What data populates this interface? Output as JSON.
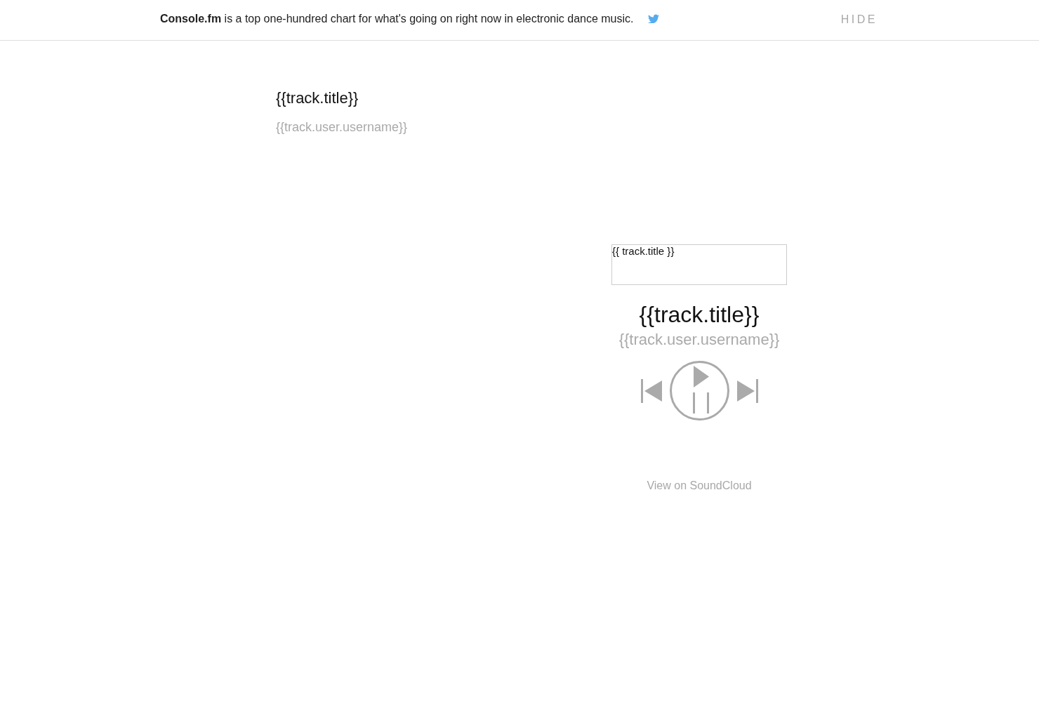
{
  "header": {
    "intro": "**Console.fm** is a top one-hundred chart for what's going on right now in electronic dance music.",
    "hide_button": "HIDE"
  },
  "track_list": [
    {
      "title": "{{track.title}}",
      "username": "{{track.user.username}}"
    }
  ],
  "player": {
    "artwork_alt": "{{ track.title }}",
    "title": "{{track.title}}",
    "username": "{{track.user.username}}",
    "link": "View on SoundCloud"
  }
}
